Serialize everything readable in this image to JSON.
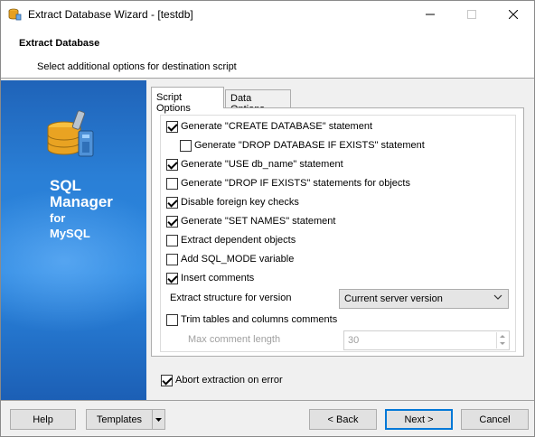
{
  "window": {
    "title": "Extract Database Wizard - [testdb]"
  },
  "header": {
    "title": "Extract Database",
    "subtitle": "Select additional options for destination script"
  },
  "banner": {
    "line1": "SQL",
    "line2": "Manager",
    "line3": "for",
    "line4": "MySQL"
  },
  "tabs": [
    {
      "label": "Script Options",
      "active": true
    },
    {
      "label": "Data Options",
      "active": false
    }
  ],
  "options": [
    {
      "label": "Generate \"CREATE DATABASE\" statement",
      "checked": true
    },
    {
      "label": "Generate \"DROP DATABASE IF EXISTS\" statement",
      "checked": false
    },
    {
      "label": "Generate \"USE db_name\" statement",
      "checked": true
    },
    {
      "label": "Generate \"DROP IF EXISTS\" statements for objects",
      "checked": false
    },
    {
      "label": "Disable foreign key checks",
      "checked": true
    },
    {
      "label": "Generate \"SET NAMES\" statement",
      "checked": true
    },
    {
      "label": "Extract dependent objects",
      "checked": false
    },
    {
      "label": "Add SQL_MODE variable",
      "checked": false
    },
    {
      "label": "Insert comments",
      "checked": true
    }
  ],
  "version": {
    "label": "Extract structure for version",
    "value": "Current server version"
  },
  "trim": {
    "label": "Trim tables and columns comments",
    "checked": false
  },
  "max_comment": {
    "label": "Max comment length",
    "value": "30"
  },
  "abort": {
    "label": "Abort extraction on error",
    "checked": true
  },
  "buttons": {
    "help": "Help",
    "templates": "Templates",
    "back": "< Back",
    "next": "Next >",
    "cancel": "Cancel"
  },
  "colors": {
    "accent": "#0078d7",
    "banner": "#2b87e0"
  },
  "icons": {
    "app": "database-wizard-icon",
    "logo": "database-tools-icon"
  }
}
